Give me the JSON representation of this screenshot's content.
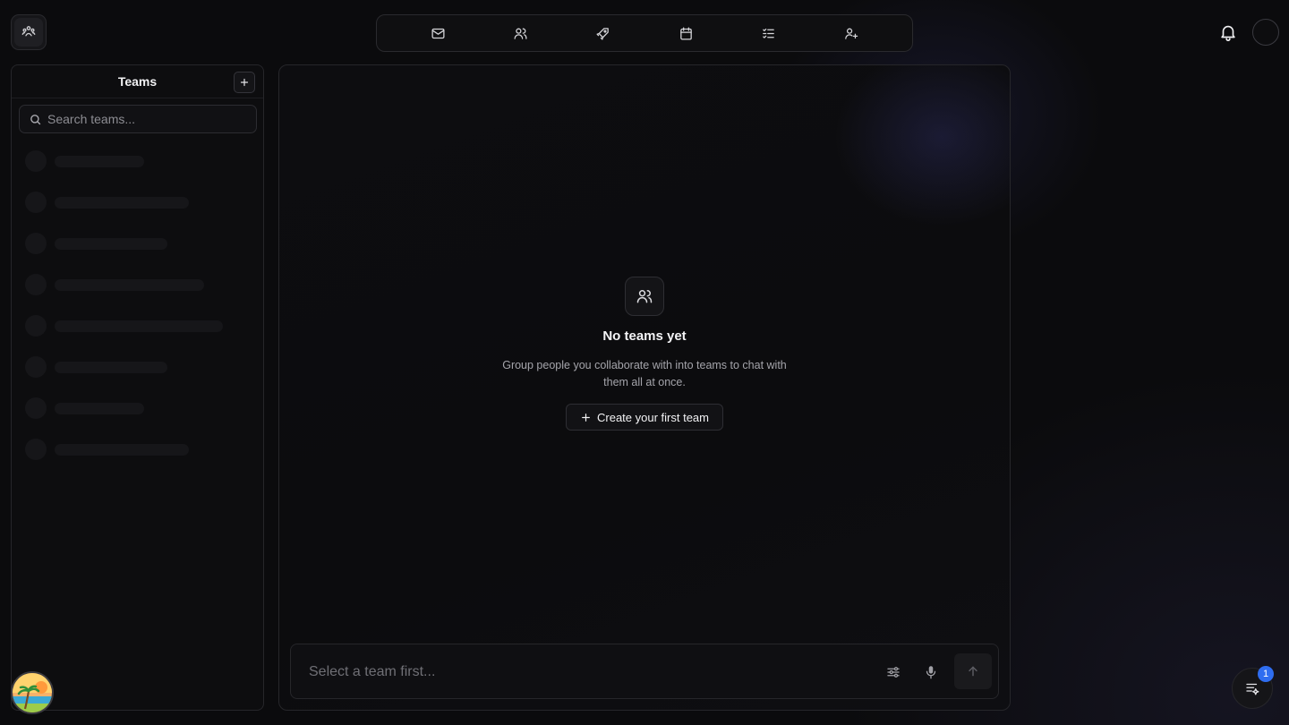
{
  "nav": {
    "items": [
      {
        "name": "mail-icon"
      },
      {
        "name": "users-icon"
      },
      {
        "name": "rocket-icon"
      },
      {
        "name": "calendar-icon"
      },
      {
        "name": "checklist-icon"
      },
      {
        "name": "user-plus-icon"
      }
    ]
  },
  "sidebar": {
    "title": "Teams",
    "search_placeholder": "Search teams...",
    "skeleton_rows": 8
  },
  "main": {
    "empty_title": "No teams yet",
    "empty_description": "Group people you collaborate with into teams to chat with them all at once.",
    "create_button_label": "Create your first team",
    "composer_placeholder": "Select a team first..."
  },
  "fab": {
    "badge_count": "1"
  },
  "colors": {
    "background": "#0b0b0d",
    "badge": "#2f6df0"
  }
}
